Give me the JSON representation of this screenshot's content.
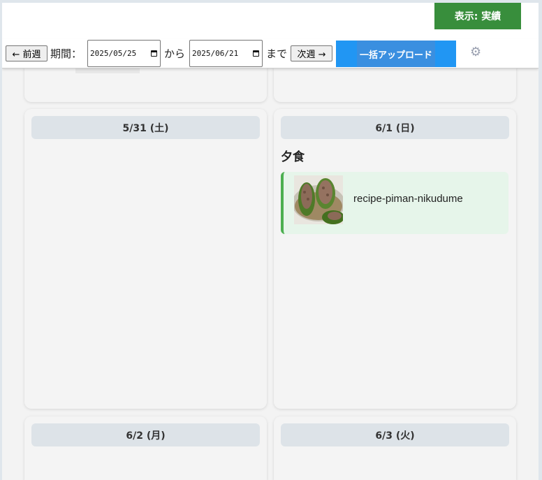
{
  "header": {
    "view_toggle_label": "表示: 実績"
  },
  "toolbar": {
    "prev_week_label": "← 前週",
    "period_label": "期間：",
    "start_date": "2025/05/25",
    "from_label": "から",
    "end_date": "2025/06/21",
    "until_label": "まで",
    "next_week_label": "次週 →",
    "bulk_upload_label": "一括アップロード",
    "settings_icon": "gear-icon"
  },
  "days": [
    {
      "date_label": "5/31 (土)",
      "meals": []
    },
    {
      "date_label": "6/1 (日)",
      "meals": [
        {
          "meal_label": "夕食",
          "recipes": [
            {
              "name": "recipe-piman-nikudume"
            }
          ]
        }
      ]
    },
    {
      "date_label": "6/2 (月)",
      "meals": []
    },
    {
      "date_label": "6/3 (火)",
      "meals": []
    }
  ],
  "colors": {
    "accent_green": "#388e3c",
    "accent_blue": "#2196f3",
    "recipe_border": "#4caf50"
  }
}
